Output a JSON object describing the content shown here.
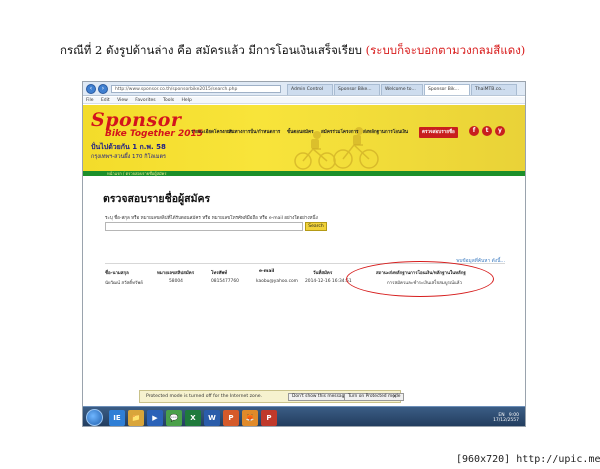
{
  "heading": {
    "main": "กรณีที่ 2 ดังรูปด้านล่าง คือ สมัครแล้ว มีการโอนเงินเสร็จเรียบ",
    "highlight": "(ระบบก็จะบอกตามวงกลมสีแดง)"
  },
  "browser": {
    "url": "http://www.sponsor.co.th/sponsorbike2015/search.php",
    "tabs": [
      "Admin Control",
      "Sponsor Bike...",
      "Welcome to...",
      "Sponsor Bik...",
      "ThaiMTB.co..."
    ],
    "menu": [
      "File",
      "Edit",
      "View",
      "Favorites",
      "Tools",
      "Help"
    ]
  },
  "site": {
    "logo": "Sponsor",
    "tagline": "Bike Together 2015",
    "date_line": "ปั่นไปด้วยกัน 1 ก.พ. 58",
    "route_line": "กรุงเทพฯ-สวนผึ้ง 170 กิโลเมตร",
    "nav": [
      "รายละเอียดโครงการ",
      "เส้นทางการปั่น/กำหนดการ",
      "ขั้นตอนสมัคร",
      "สมัครร่วมโครงการ",
      "ส่งหลักฐานการโอนเงิน"
    ],
    "cta": "ตรวจสอบรายชื่อ",
    "social": [
      "f",
      "t",
      "y"
    ],
    "breadcrumb": "หน้าแรก  /  ตรวจสอบรายชื่อผู้สมัคร"
  },
  "content": {
    "title": "ตรวจสอบรายชื่อผู้สมัคร",
    "hint": "ระบุ ชื่อ-สกุล หรือ หมายเลขสลิปที่ได้รับตอนสมัคร หรือ หมายเลขโทรศัพท์มือถือ หรือ e-mail อย่างใดอย่างหนึ่ง",
    "search_button": "Search",
    "found_text": "พบข้อมูลที่ค้นหา ดังนี้..."
  },
  "table": {
    "headers": [
      "ชื่อ-นามสกุล",
      "หมายเลขสลิปสมัคร",
      "โทรศัพท์",
      "e-mail",
      "วันที่สมัคร",
      "สถานะส่งหลักฐานการโอนเงิน/หลักฐานในหลักฐ"
    ],
    "row": [
      "นัยวัฒน์ สวัสดิ์ทรัพย์",
      "58004",
      "0815477760",
      "kaobu@yahoo.com",
      "2014-12-16 16:34:51",
      "การสมัครและชำระเงินเสร็จสมบูรณ์แล้ว"
    ]
  },
  "notification": {
    "text": "Protected mode is turned off for the Internet zone.",
    "btn_dont_show": "Don't show this message again",
    "btn_turn_on": "Turn on Protected mode",
    "close": "×"
  },
  "taskbar": {
    "apps": [
      "IE",
      "📁",
      "▶",
      "💬",
      "X",
      "W",
      "P",
      "🦊",
      "P"
    ],
    "tray_lang": "EN",
    "tray_time": "9:00",
    "tray_date": "17/12/2557"
  },
  "footer": "[960x720] http://upic.me/"
}
